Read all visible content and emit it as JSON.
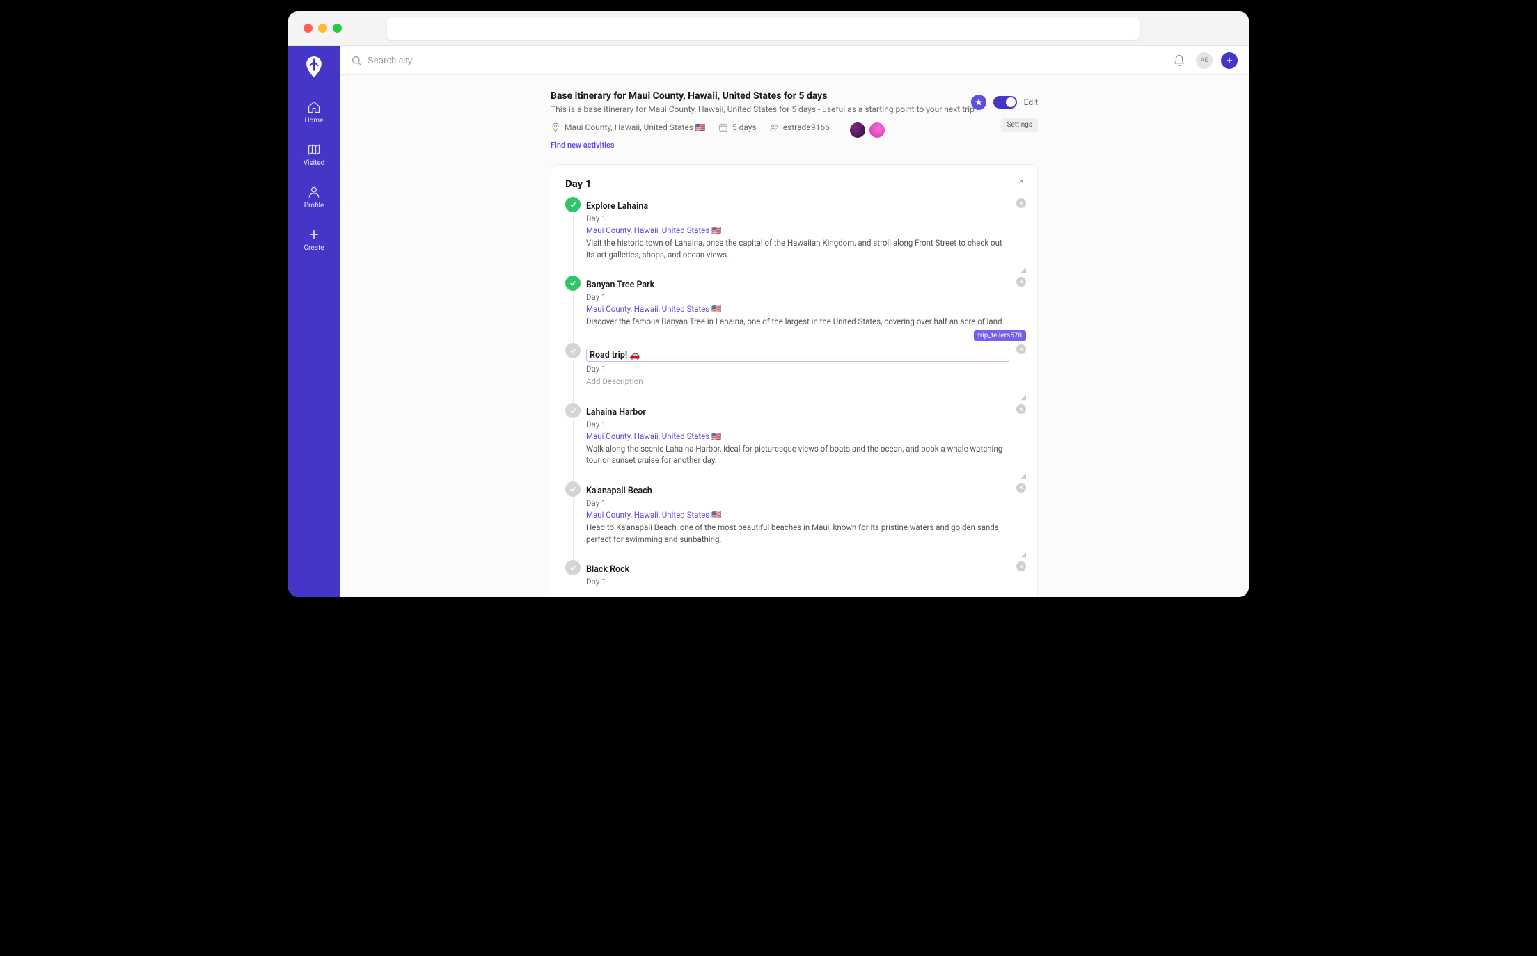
{
  "titlebar": {},
  "sidebar": {
    "items": [
      {
        "label": "Home"
      },
      {
        "label": "Visited"
      },
      {
        "label": "Profile"
      },
      {
        "label": "Create"
      }
    ]
  },
  "topbar": {
    "search_placeholder": "Search city",
    "avatar_initials": "AE"
  },
  "header": {
    "title": "Base itinerary for Maui County, Hawaii, United States for 5 days",
    "subtitle": "This is a base itinerary for Maui County, Hawaii, United States for 5 days - useful as a starting point to your next trip",
    "location": "Maui County, Hawaii, United States 🇺🇸",
    "duration": "5 days",
    "author": "estrada9166",
    "find_link": "Find new activities",
    "edit_label": "Edit",
    "settings_label": "Settings"
  },
  "day": {
    "title": "Day 1",
    "activities": [
      {
        "title": "Explore Lahaina",
        "day_label": "Day 1",
        "location": "Maui County, Hawaii, United States 🇺🇸",
        "description": "Visit the historic town of Lahaina, once the capital of the Hawaiian Kingdom, and stroll along Front Street to check out its art galleries, shops, and ocean views.",
        "done": true
      },
      {
        "title": "Banyan Tree Park",
        "day_label": "Day 1",
        "location": "Maui County, Hawaii, United States 🇺🇸",
        "description": "Discover the famous Banyan Tree in Lahaina, one of the largest in the United States, covering over half an acre of land.",
        "done": true
      },
      {
        "title": "Road trip! 🚗",
        "day_label": "Day 1",
        "location": "",
        "description": "Add Description",
        "done": false,
        "editing": true,
        "editor_tag": "trip_tellers578"
      },
      {
        "title": "Lahaina Harbor",
        "day_label": "Day 1",
        "location": "Maui County, Hawaii, United States 🇺🇸",
        "description": "Walk along the scenic Lahaina Harbor, ideal for picturesque views of boats and the ocean, and book a whale watching tour or sunset cruise for another day.",
        "done": false
      },
      {
        "title": "Ka'anapali Beach",
        "day_label": "Day 1",
        "location": "Maui County, Hawaii, United States 🇺🇸",
        "description": "Head to Ka'anapali Beach, one of the most beautiful beaches in Maui, known for its pristine waters and golden sands perfect for swimming and sunbathing.",
        "done": false
      },
      {
        "title": "Black Rock",
        "day_label": "Day 1",
        "location": "",
        "description": "",
        "done": false
      }
    ]
  }
}
